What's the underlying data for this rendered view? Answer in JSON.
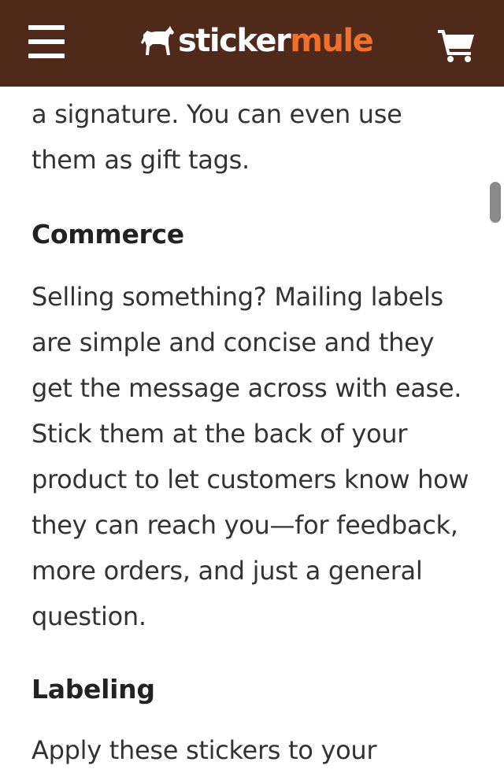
{
  "header": {
    "logo_sticker": "sticker",
    "logo_mule": "mule",
    "menu_icon": "hamburger-menu-icon",
    "cart_icon": "shopping-cart-icon",
    "logo_icon": "mule-logo-icon"
  },
  "content": {
    "intro_text": "a signature. You can even use them as gift tags.",
    "commerce_heading": "Commerce",
    "commerce_text": "Selling something? Mailing labels are simple and concise and they get the message across with ease. Stick them at the back of your product to let customers know how they can reach you—for feedback, more orders, and just a general question.",
    "labeling_heading": "Labeling",
    "labeling_text": "Apply these stickers to your"
  },
  "colors": {
    "header_bg": "#4f2a1b",
    "brand_orange": "#f26f2b",
    "text": "#333333"
  }
}
